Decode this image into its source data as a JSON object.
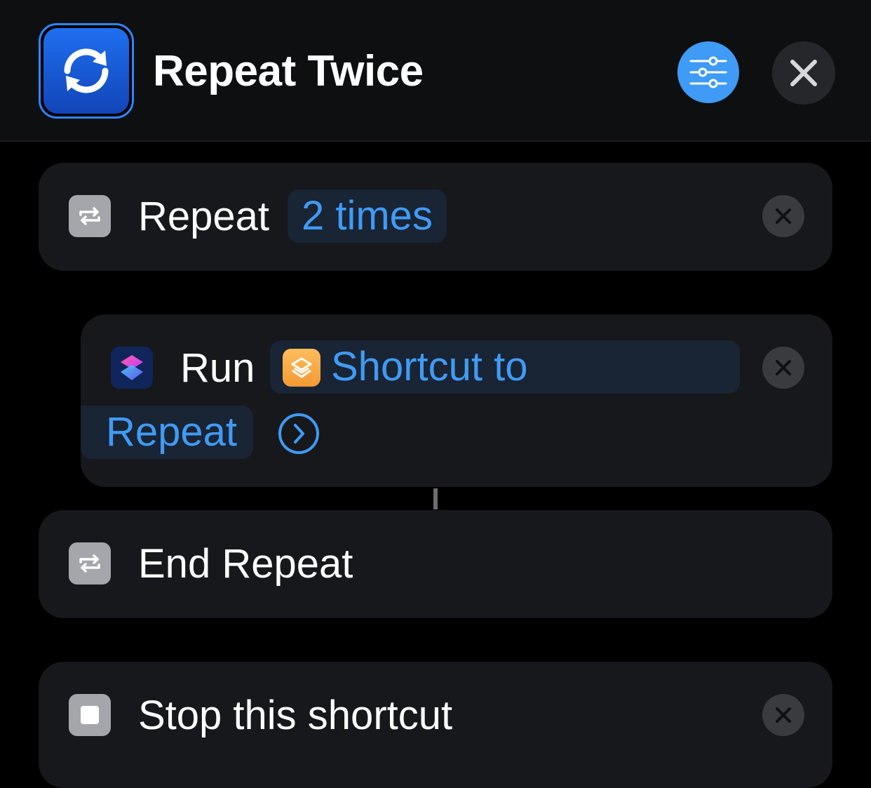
{
  "header": {
    "title": "Repeat Twice",
    "icon": "repeat-arrows-icon",
    "settings_icon": "sliders-icon",
    "close_icon": "close-icon",
    "accent_color": "#3f9bf5"
  },
  "actions": [
    {
      "icon": "repeat-icon",
      "label": "Repeat",
      "parameter": "2 times",
      "remove_icon": "close-icon"
    },
    {
      "icon": "shortcuts-app-icon",
      "label": "Run",
      "shortcut_icon": "layers-icon",
      "parameter_line1": "Shortcut to",
      "parameter_line2": "Repeat",
      "expand_icon": "chevron-right-circle-icon",
      "remove_icon": "close-icon"
    },
    {
      "icon": "repeat-icon",
      "label": "End Repeat"
    },
    {
      "icon": "stop-icon",
      "label": "Stop this shortcut",
      "remove_icon": "close-icon"
    }
  ]
}
